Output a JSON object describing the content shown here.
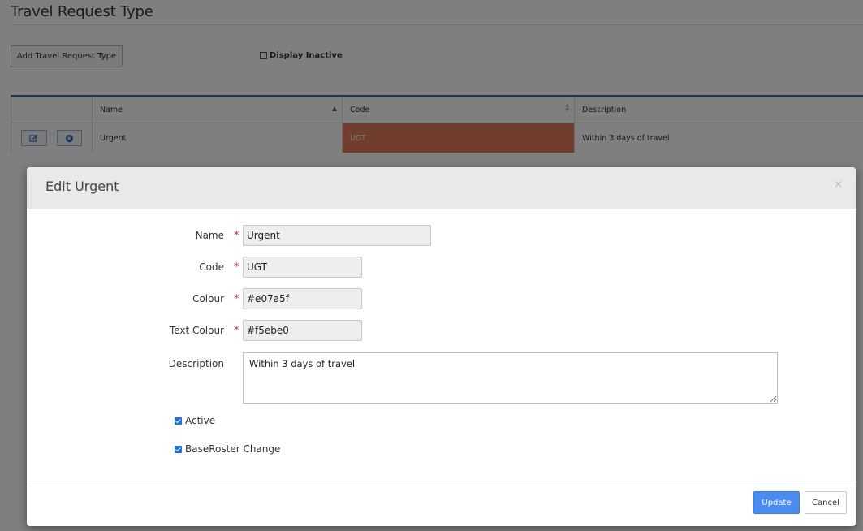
{
  "page": {
    "title": "Travel Request Type",
    "add_button": "Add Travel Request Type",
    "display_inactive_label": "Display Inactive"
  },
  "grid": {
    "headers": {
      "name": "Name",
      "code": "Code",
      "description": "Description"
    },
    "rows": [
      {
        "name": "Urgent",
        "code": "UGT",
        "description": "Within 3 days of travel",
        "colour": "#e07a5f",
        "text_colour": "#f5ebe0"
      }
    ]
  },
  "modal": {
    "title": "Edit Urgent",
    "close_symbol": "×",
    "fields": {
      "name": {
        "label": "Name",
        "value": "Urgent"
      },
      "code": {
        "label": "Code",
        "value": "UGT"
      },
      "colour": {
        "label": "Colour",
        "value": "#e07a5f"
      },
      "text_colour": {
        "label": "Text Colour",
        "value": "#f5ebe0"
      },
      "description": {
        "label": "Description",
        "value": "Within 3 days of travel"
      }
    },
    "required_marker": "*",
    "checkboxes": {
      "active": {
        "label": "Active",
        "checked": true
      },
      "baseroster_change": {
        "label": "BaseRoster Change",
        "checked": true
      }
    },
    "buttons": {
      "update": "Update",
      "cancel": "Cancel"
    }
  },
  "icons": {
    "edit": "edit-icon",
    "delete": "delete-icon",
    "sort_asc": "sort-ascending-icon",
    "sort_both": "sort-icon"
  },
  "colors": {
    "accent": "#2e6fba",
    "primary_button": "#4b8bf0",
    "required": "#c9302c"
  }
}
